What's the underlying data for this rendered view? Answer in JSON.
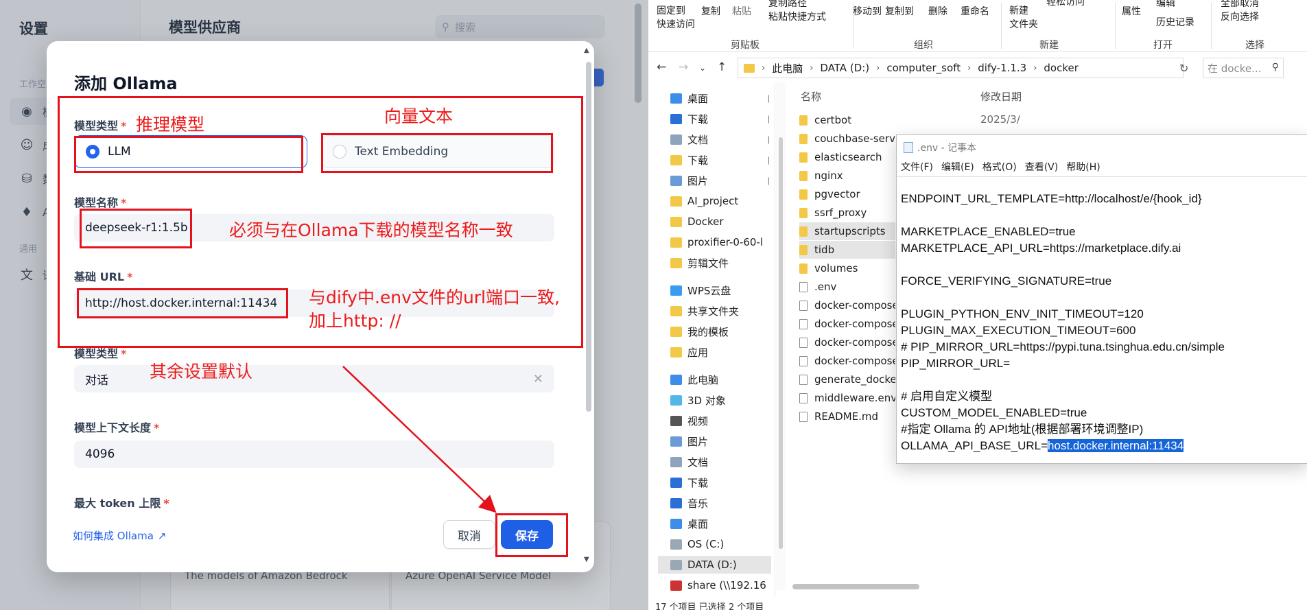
{
  "dify": {
    "settings_title": "设置",
    "workspace_label": "工作空",
    "general_label": "通用",
    "nav_items": [
      {
        "label": "模",
        "icon": "brain-icon"
      },
      {
        "label": "成",
        "icon": "palette-icon"
      },
      {
        "label": "数",
        "icon": "database-icon"
      },
      {
        "label": "A",
        "icon": "puzzle-icon"
      },
      {
        "label": "语",
        "icon": "translate-icon"
      }
    ],
    "main_title": "模型供应商",
    "search_placeholder": "搜索",
    "bg_cards": [
      {
        "desc": "The models of Amazon Bedrock"
      },
      {
        "desc": "Azure OpenAI Service Model"
      }
    ]
  },
  "modal": {
    "title": "添加 Ollama",
    "model_type_label": "模型类型",
    "required_mark": "*",
    "model_type_options": [
      {
        "label": "LLM",
        "selected": true
      },
      {
        "label": "Text Embedding",
        "selected": false
      }
    ],
    "model_name_label": "模型名称",
    "model_name_value": "deepseek-r1:1.5b",
    "base_url_label": "基础 URL",
    "base_url_value": "http://host.docker.internal:11434",
    "model_type2_label": "模型类型",
    "model_type2_value": "对话",
    "context_length_label": "模型上下文长度",
    "context_length_value": "4096",
    "max_token_label": "最大 token 上限",
    "help_link": "如何集成 Ollama",
    "cancel_label": "取消",
    "save_label": "保存"
  },
  "annotations": {
    "inference_model": "推理模型",
    "vector_text": "向量文本",
    "name_note": "必须与在Ollama下载的模型名称一致",
    "url_note_line1": "与dify中.env文件的url端口一致,",
    "url_note_line2": "加上http: //",
    "defaults_note": "其余设置默认",
    "color": "#e5111b"
  },
  "explorer": {
    "ribbon": {
      "pin_quick": "固定到\n快速访问",
      "copy": "复制",
      "paste": "粘贴",
      "copy_path": "复制路径",
      "paste_shortcut": "粘贴快捷方式",
      "move_to": "移动到",
      "copy_to": "复制到",
      "delete": "删除",
      "rename": "重命名",
      "new_folder": "新建\n文件夹",
      "easy_access": "轻松访问",
      "properties": "属性",
      "edit": "编辑",
      "history": "历史记录",
      "select_all": "全部取消",
      "invert_select": "反向选择",
      "group_clipboard": "剪贴板",
      "group_organize": "组织",
      "group_new": "新建",
      "group_open": "打开",
      "group_select": "选择"
    },
    "path": [
      "此电脑",
      "DATA (D:)",
      "computer_soft",
      "dify-1.1.3",
      "docker"
    ],
    "search_placeholder": "在 docke...",
    "nav_items": [
      {
        "label": "桌面",
        "icon": "desktop-icon",
        "pinned": true
      },
      {
        "label": "下载",
        "icon": "download-icon",
        "pinned": true
      },
      {
        "label": "文档",
        "icon": "document-icon",
        "pinned": true
      },
      {
        "label": "下载",
        "icon": "folder-icon",
        "pinned": true
      },
      {
        "label": "图片",
        "icon": "picture-icon",
        "pinned": true
      },
      {
        "label": "AI_project",
        "icon": "folder-icon",
        "pinned": false
      },
      {
        "label": "Docker",
        "icon": "folder-icon",
        "pinned": false
      },
      {
        "label": "proxifier-0-60-l",
        "icon": "folder-icon",
        "pinned": false
      },
      {
        "label": "剪辑文件",
        "icon": "folder-icon",
        "pinned": false
      },
      {
        "label": "WPS云盘",
        "icon": "cloud-icon",
        "pinned": false
      },
      {
        "label": "共享文件夹",
        "icon": "folder-icon",
        "pinned": false
      },
      {
        "label": "我的模板",
        "icon": "folder-icon",
        "pinned": false
      },
      {
        "label": "应用",
        "icon": "folder-icon",
        "pinned": false
      },
      {
        "label": "此电脑",
        "icon": "computer-icon",
        "pinned": false
      },
      {
        "label": "3D 对象",
        "icon": "cube-icon",
        "pinned": false
      },
      {
        "label": "视频",
        "icon": "video-icon",
        "pinned": false
      },
      {
        "label": "图片",
        "icon": "picture-icon",
        "pinned": false
      },
      {
        "label": "文档",
        "icon": "document-icon",
        "pinned": false
      },
      {
        "label": "下载",
        "icon": "download-icon",
        "pinned": false
      },
      {
        "label": "音乐",
        "icon": "music-icon",
        "pinned": false
      },
      {
        "label": "桌面",
        "icon": "desktop-icon",
        "pinned": false
      },
      {
        "label": "OS (C:)",
        "icon": "drive-icon",
        "pinned": false
      },
      {
        "label": "DATA (D:)",
        "icon": "drive-icon",
        "pinned": false
      },
      {
        "label": "share (\\\\192.16",
        "icon": "network-drive-icon",
        "pinned": false
      }
    ],
    "columns": {
      "name": "名称",
      "modified": "修改日期"
    },
    "files": [
      {
        "name": "certbot",
        "type": "folder",
        "date": "2025/3/"
      },
      {
        "name": "couchbase-server",
        "type": "folder",
        "date": ""
      },
      {
        "name": "elasticsearch",
        "type": "folder",
        "date": ""
      },
      {
        "name": "nginx",
        "type": "folder",
        "date": ""
      },
      {
        "name": "pgvector",
        "type": "folder",
        "date": ""
      },
      {
        "name": "ssrf_proxy",
        "type": "folder",
        "date": ""
      },
      {
        "name": "startupscripts",
        "type": "folder",
        "date": "",
        "selected": true
      },
      {
        "name": "tidb",
        "type": "folder",
        "date": "",
        "selected": true
      },
      {
        "name": "volumes",
        "type": "folder",
        "date": ""
      },
      {
        "name": ".env",
        "type": "file",
        "date": ""
      },
      {
        "name": "docker-compose",
        "type": "file",
        "date": ""
      },
      {
        "name": "docker-compose",
        "type": "file",
        "date": ""
      },
      {
        "name": "docker-compose",
        "type": "file",
        "date": ""
      },
      {
        "name": "docker-compose",
        "type": "file",
        "date": ""
      },
      {
        "name": "generate_docke",
        "type": "file",
        "date": ""
      },
      {
        "name": "middleware.env.",
        "type": "file",
        "date": ""
      },
      {
        "name": "README.md",
        "type": "file",
        "date": ""
      }
    ],
    "status": "17 个项目    已选择 2 个项目"
  },
  "notepad": {
    "title": ".env - 记事本",
    "menu": [
      "文件(F)",
      "编辑(E)",
      "格式(O)",
      "查看(V)",
      "帮助(H)"
    ],
    "lines": [
      "ENDPOINT_URL_TEMPLATE=http://localhost/e/{hook_id}",
      "",
      "MARKETPLACE_ENABLED=true",
      "MARKETPLACE_API_URL=https://marketplace.dify.ai",
      "",
      "FORCE_VERIFYING_SIGNATURE=true",
      "",
      "PLUGIN_PYTHON_ENV_INIT_TIMEOUT=120",
      "PLUGIN_MAX_EXECUTION_TIMEOUT=600",
      "# PIP_MIRROR_URL=https://pypi.tuna.tsinghua.edu.cn/simple",
      "PIP_MIRROR_URL=",
      "",
      "# 启用自定义模型",
      "CUSTOM_MODEL_ENABLED=true",
      "#指定 Ollama 的 API地址(根据部署环境调整IP)"
    ],
    "last_line_prefix": "OLLAMA_API_BASE_URL=",
    "last_line_selected": "host.docker.internal:11434"
  }
}
